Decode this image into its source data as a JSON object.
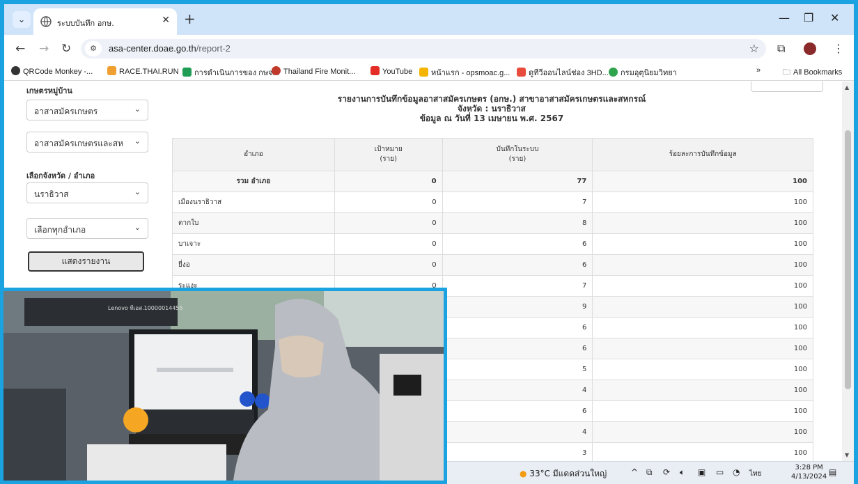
{
  "browser": {
    "tab_title": "ระบบบันทึก อกษ.",
    "url_host": "asa-center.doae.go.th",
    "url_path": "/report-2",
    "bookmarks": [
      "QRCode Monkey -...",
      "RACE.THAI.RUN",
      "การดำเนินการของ กษจ...",
      "Thailand Fire Monit...",
      "YouTube",
      "หน้าแรก - opsmoac.g...",
      "ดูทีวีออนไลน์ช่อง 3HD...",
      "กรมอุตุนิยมวิทยา"
    ],
    "all_bookmarks": "All Bookmarks",
    "overflow": "»"
  },
  "sidebar": {
    "top_label": "เกษตรหมู่บ้าน",
    "select_volunteer": "อาสาสมัครเกษตร",
    "select_branch": "อาสาสมัครเกษตรและสห",
    "province_label": "เลือกจังหวัด / อำเภอ",
    "select_province": "นราธิวาส",
    "select_district": "เลือกทุกอำเภอ",
    "report_button": "แสดงรายงาน"
  },
  "report": {
    "title": "รายงานการบันทึกข้อมูลอาสาสมัครเกษตร (อกษ.) สาขาอาสาสมัครเกษตรและสหกรณ์",
    "province_line": "จังหวัด : นราธิวาส",
    "date_line": "ข้อมูล ณ วันที่ 13 เมษายน พ.ศ. 2567",
    "columns": [
      "อำเภอ",
      "เป้าหมาย",
      "(ราย)",
      "บันทึกในระบบ",
      "(ราย)",
      "ร้อยละการบันทึกข้อมูล"
    ],
    "total_row": {
      "district": "รวม อำเภอ",
      "target": "0",
      "recorded": "77",
      "percent": "100"
    },
    "rows": [
      {
        "district": "เมืองนราธิวาส",
        "target": "0",
        "recorded": "7",
        "percent": "100"
      },
      {
        "district": "ตากใบ",
        "target": "0",
        "recorded": "8",
        "percent": "100"
      },
      {
        "district": "บาเจาะ",
        "target": "0",
        "recorded": "6",
        "percent": "100"
      },
      {
        "district": "ยี่งอ",
        "target": "0",
        "recorded": "6",
        "percent": "100"
      },
      {
        "district": "ระแงะ",
        "target": "0",
        "recorded": "7",
        "percent": "100"
      },
      {
        "district": "",
        "target": "",
        "recorded": "9",
        "percent": "100"
      },
      {
        "district": "",
        "target": "",
        "recorded": "6",
        "percent": "100"
      },
      {
        "district": "",
        "target": "",
        "recorded": "6",
        "percent": "100"
      },
      {
        "district": "",
        "target": "",
        "recorded": "5",
        "percent": "100"
      },
      {
        "district": "",
        "target": "",
        "recorded": "4",
        "percent": "100"
      },
      {
        "district": "",
        "target": "",
        "recorded": "6",
        "percent": "100"
      },
      {
        "district": "",
        "target": "",
        "recorded": "4",
        "percent": "100"
      },
      {
        "district": "",
        "target": "",
        "recorded": "3",
        "percent": "100"
      }
    ]
  },
  "taskbar": {
    "weather": "33°C มีแดดส่วนใหญ่",
    "language": "ไทย",
    "time": "3:28 PM",
    "date": "4/13/2024"
  },
  "photo": {
    "monitor_label": "Lenovo ทีเอส.10000014455"
  },
  "colors": {
    "frame_border": "#1aa3e0",
    "tab_strip": "#cfe3f9"
  }
}
